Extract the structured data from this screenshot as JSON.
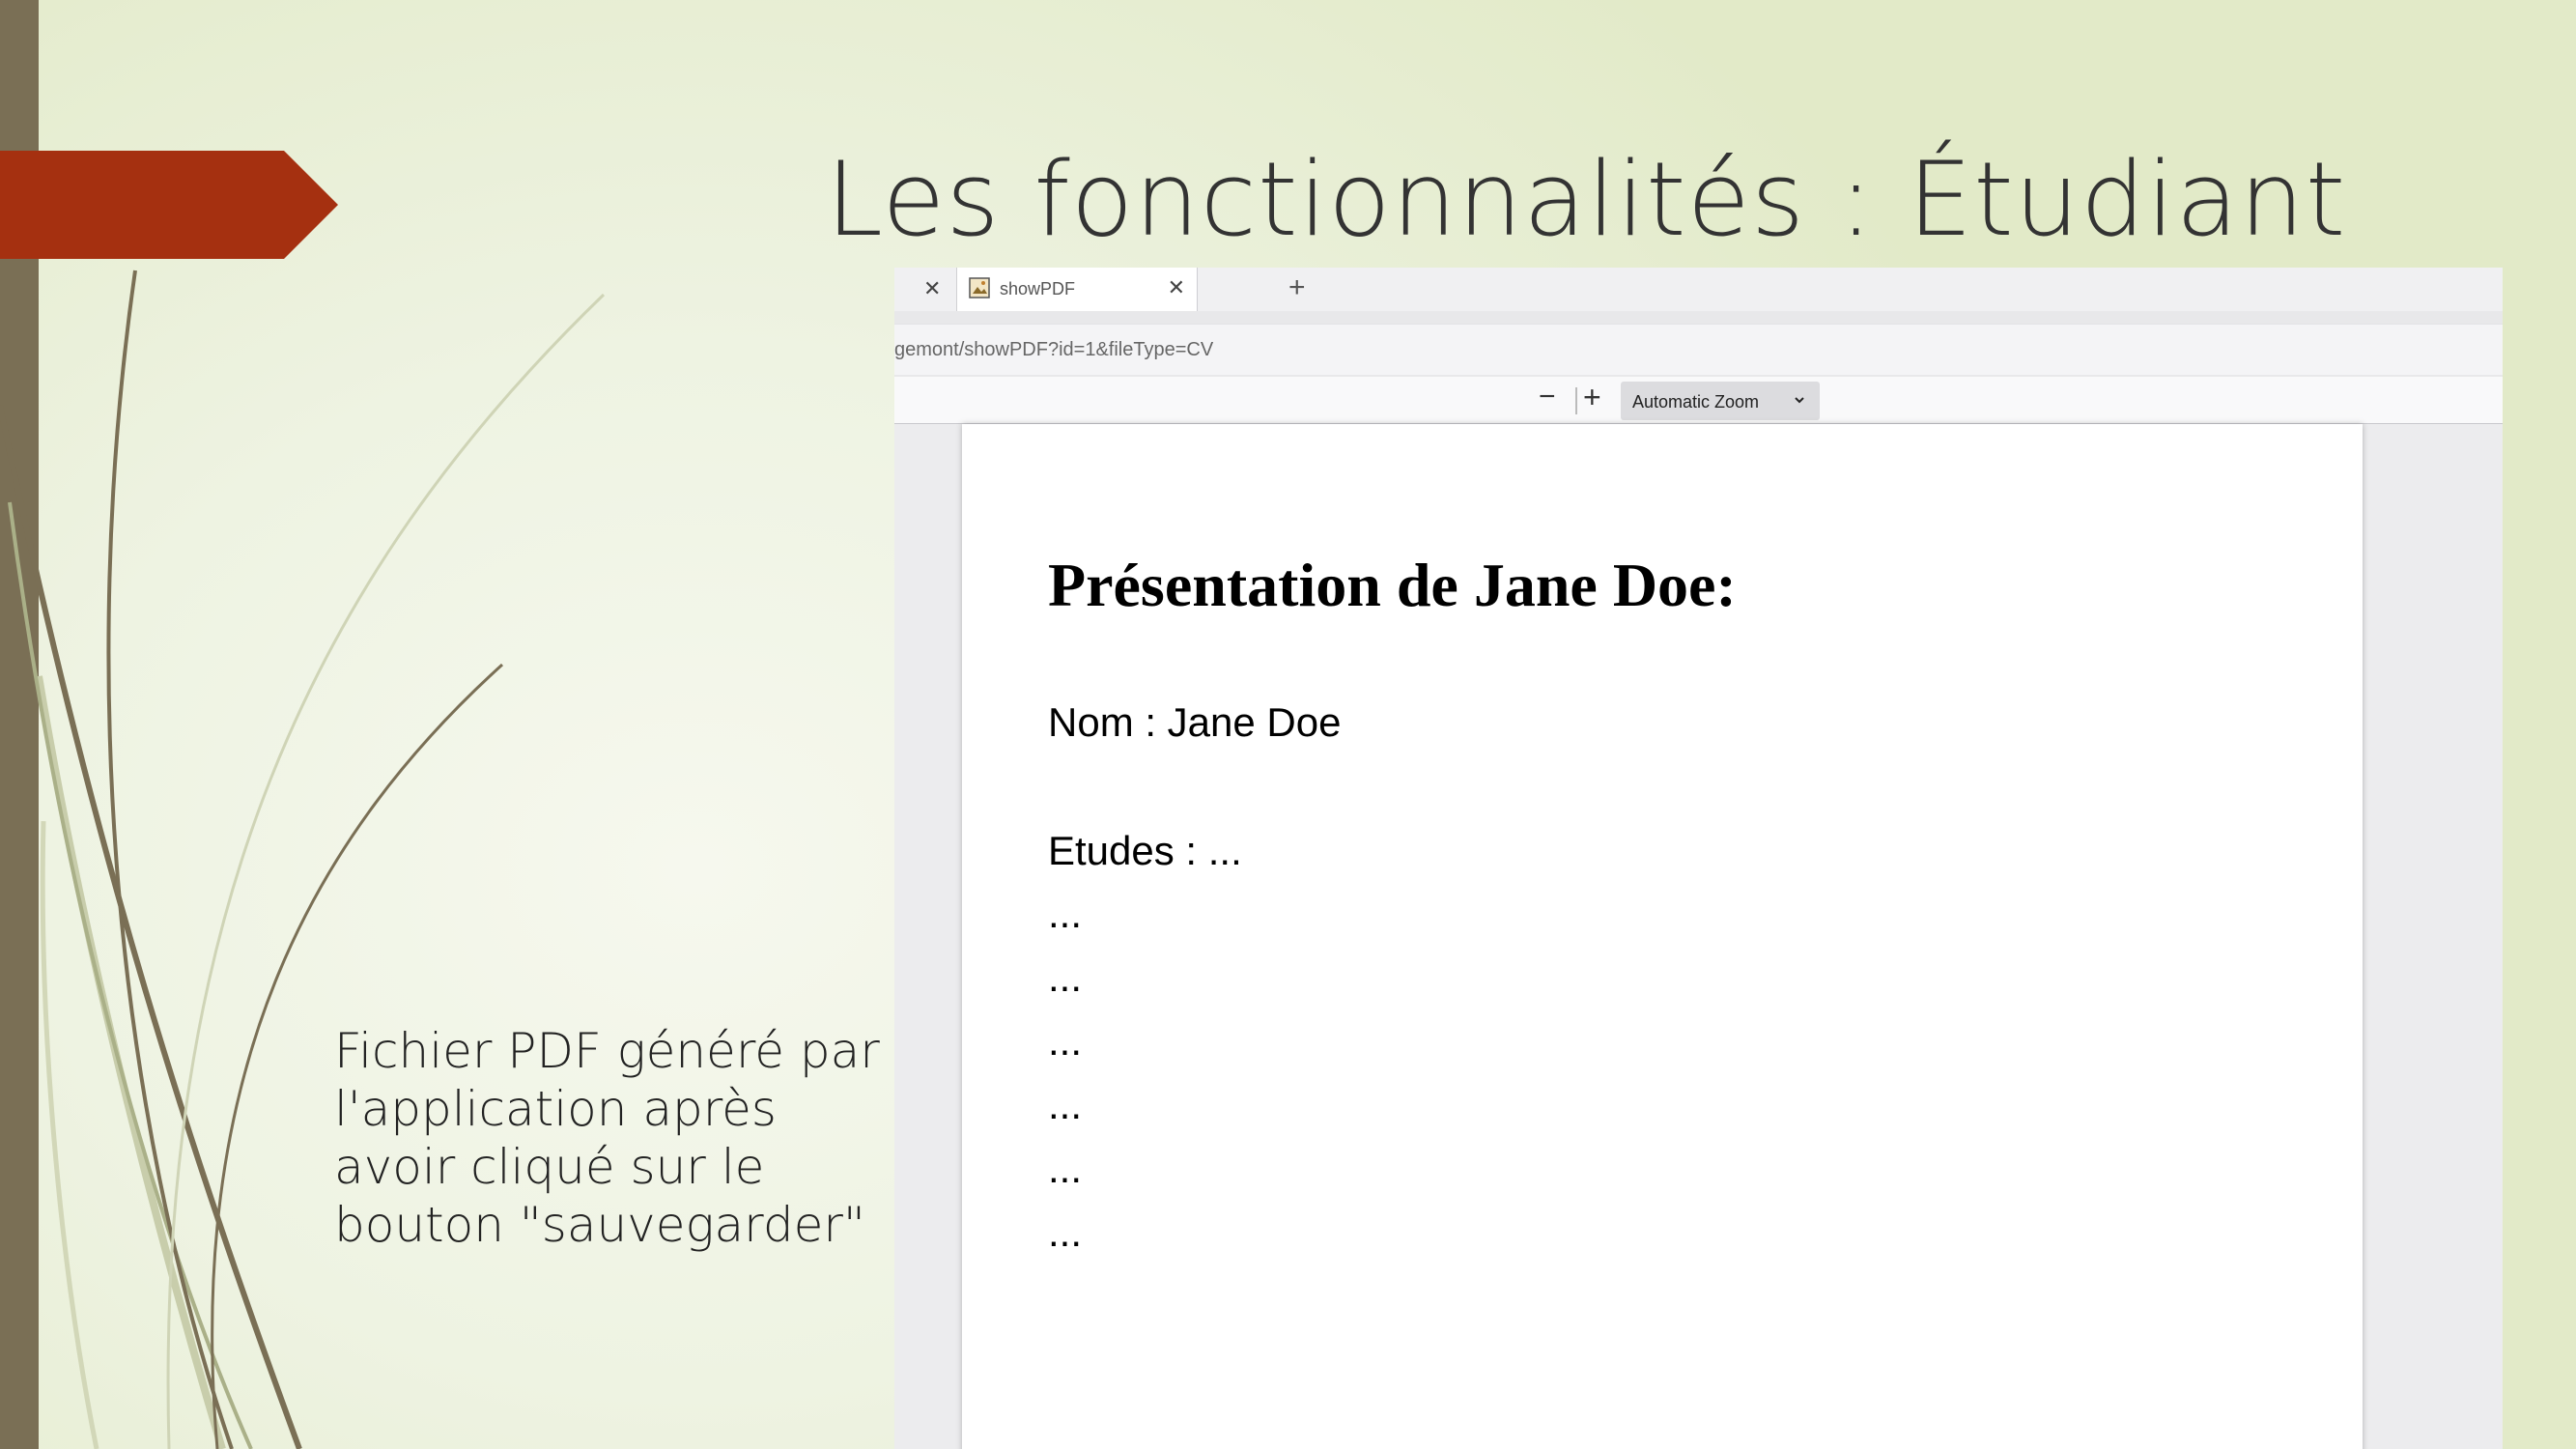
{
  "slide": {
    "title": "Les fonctionnalités : Étudiant",
    "caption": "Fichier PDF généré par l'application après avoir cliqué sur le bouton \"sauvegarder\""
  },
  "browser": {
    "tab": {
      "label": "showPDF"
    },
    "address": {
      "url": "gemont/showPDF?id=1&fileType=CV"
    },
    "toolbar": {
      "zoom_out": "−",
      "zoom_in": "+",
      "zoom_label": "Automatic Zoom"
    }
  },
  "document": {
    "heading": "Présentation de Jane Doe:",
    "name_line": "Nom : Jane Doe",
    "studies_line": "Etudes : ...",
    "ellipsis_lines": [
      "...",
      "...",
      "...",
      "...",
      "...",
      "..."
    ]
  },
  "colors": {
    "accent_banner": "#a53010",
    "left_bar": "#7a6f55",
    "background": "#eef3e2"
  },
  "icons": {
    "close": "close-icon",
    "add": "plus-icon",
    "favicon": "image-favicon-icon",
    "chevron": "chevron-down-icon"
  }
}
